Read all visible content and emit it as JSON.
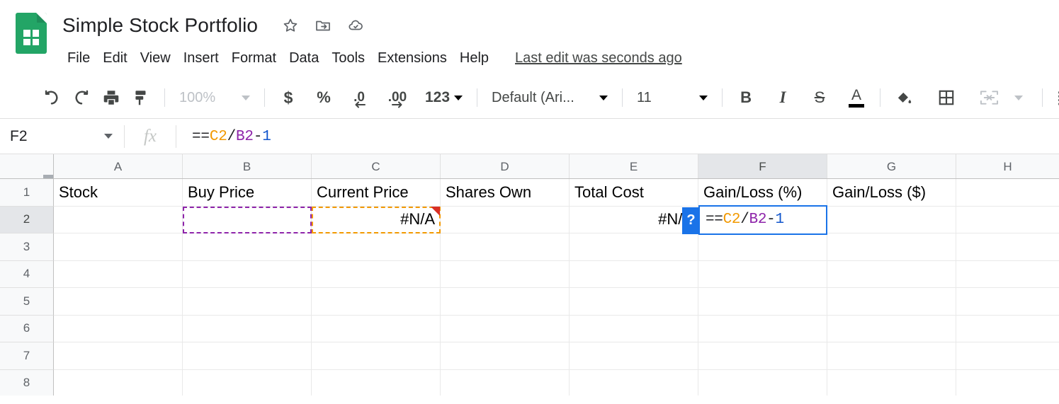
{
  "app": {
    "logo_name": "google-sheets-logo",
    "title": "Simple Stock Portfolio",
    "title_icons": [
      {
        "name": "star-icon",
        "label": "Star"
      },
      {
        "name": "move-to-folder-icon",
        "label": "Move"
      },
      {
        "name": "cloud-saved-icon",
        "label": "Saved to Drive"
      }
    ],
    "last_edit": "Last edit was seconds ago"
  },
  "menubar": {
    "items": [
      {
        "name": "menu-file",
        "label": "File"
      },
      {
        "name": "menu-edit",
        "label": "Edit"
      },
      {
        "name": "menu-view",
        "label": "View"
      },
      {
        "name": "menu-insert",
        "label": "Insert"
      },
      {
        "name": "menu-format",
        "label": "Format"
      },
      {
        "name": "menu-data",
        "label": "Data"
      },
      {
        "name": "menu-tools",
        "label": "Tools"
      },
      {
        "name": "menu-extensions",
        "label": "Extensions"
      },
      {
        "name": "menu-help",
        "label": "Help"
      }
    ]
  },
  "toolbar": {
    "undo": "undo-icon",
    "redo": "redo-icon",
    "print": "print-icon",
    "paint_format": "paint-format-icon",
    "zoom_value": "100%",
    "currency": "$",
    "percent": "%",
    "decrease_decimal": ".0",
    "increase_decimal": ".00",
    "number_format": "123",
    "font_family": "Default (Ari...",
    "font_size": "11",
    "bold": "B",
    "italic": "I",
    "strikethrough": "S",
    "text_color": "A",
    "text_color_swatch": "#000000",
    "fill_color": "fill-color-icon",
    "borders": "borders-icon",
    "merge_cells": "merge-cells-icon",
    "align": "align-left-icon"
  },
  "formula_bar": {
    "name_box": "F2",
    "fx_label": "fx",
    "formula_tokens": [
      {
        "text": "==",
        "color": "#202124"
      },
      {
        "text": "C2",
        "color": "#F29900"
      },
      {
        "text": "/",
        "color": "#202124"
      },
      {
        "text": "B2",
        "color": "#8E24AA"
      },
      {
        "text": "-",
        "color": "#202124"
      },
      {
        "text": "1",
        "color": "#1155CC"
      }
    ]
  },
  "sheet": {
    "column_headers": [
      "A",
      "B",
      "C",
      "D",
      "E",
      "F",
      "G",
      "H"
    ],
    "active_column": "F",
    "active_row": "2",
    "row_headers": [
      "1",
      "2",
      "3",
      "4",
      "5",
      "6",
      "7",
      "8"
    ],
    "rows": [
      {
        "number": "1",
        "cells": [
          {
            "name": "cell-A1",
            "value": "Stock",
            "align": "left"
          },
          {
            "name": "cell-B1",
            "value": "Buy Price",
            "align": "left"
          },
          {
            "name": "cell-C1",
            "value": "Current Price",
            "align": "left"
          },
          {
            "name": "cell-D1",
            "value": "Shares Own",
            "align": "left"
          },
          {
            "name": "cell-E1",
            "value": "Total Cost",
            "align": "left"
          },
          {
            "name": "cell-F1",
            "value": "Gain/Loss (%)",
            "align": "left"
          },
          {
            "name": "cell-G1",
            "value": "Gain/Loss ($)",
            "align": "left"
          },
          {
            "name": "cell-H1",
            "value": "",
            "align": "left"
          }
        ]
      },
      {
        "number": "2",
        "cells": [
          {
            "name": "cell-A2",
            "value": "",
            "align": "left"
          },
          {
            "name": "cell-B2",
            "value": "",
            "align": "left"
          },
          {
            "name": "cell-C2",
            "value": "#N/A",
            "align": "right"
          },
          {
            "name": "cell-D2",
            "value": "",
            "align": "left"
          },
          {
            "name": "cell-E2",
            "value": "#N/A",
            "align": "right"
          },
          {
            "name": "cell-F2",
            "value": "",
            "align": "left"
          },
          {
            "name": "cell-G2",
            "value": "",
            "align": "left"
          },
          {
            "name": "cell-H2",
            "value": "",
            "align": "left"
          }
        ]
      },
      {
        "number": "3",
        "cells": [
          {
            "name": "cell-A3",
            "value": "",
            "align": "left"
          },
          {
            "name": "cell-B3",
            "value": "",
            "align": "left"
          },
          {
            "name": "cell-C3",
            "value": "",
            "align": "left"
          },
          {
            "name": "cell-D3",
            "value": "",
            "align": "left"
          },
          {
            "name": "cell-E3",
            "value": "",
            "align": "left"
          },
          {
            "name": "cell-F3",
            "value": "",
            "align": "left"
          },
          {
            "name": "cell-G3",
            "value": "",
            "align": "left"
          },
          {
            "name": "cell-H3",
            "value": "",
            "align": "left"
          }
        ]
      },
      {
        "number": "4",
        "cells": [
          {
            "name": "cell-A4",
            "value": "",
            "align": "left"
          },
          {
            "name": "cell-B4",
            "value": "",
            "align": "left"
          },
          {
            "name": "cell-C4",
            "value": "",
            "align": "left"
          },
          {
            "name": "cell-D4",
            "value": "",
            "align": "left"
          },
          {
            "name": "cell-E4",
            "value": "",
            "align": "left"
          },
          {
            "name": "cell-F4",
            "value": "",
            "align": "left"
          },
          {
            "name": "cell-G4",
            "value": "",
            "align": "left"
          },
          {
            "name": "cell-H4",
            "value": "",
            "align": "left"
          }
        ]
      },
      {
        "number": "5",
        "cells": [
          {
            "name": "cell-A5",
            "value": "",
            "align": "left"
          },
          {
            "name": "cell-B5",
            "value": "",
            "align": "left"
          },
          {
            "name": "cell-C5",
            "value": "",
            "align": "left"
          },
          {
            "name": "cell-D5",
            "value": "",
            "align": "left"
          },
          {
            "name": "cell-E5",
            "value": "",
            "align": "left"
          },
          {
            "name": "cell-F5",
            "value": "",
            "align": "left"
          },
          {
            "name": "cell-G5",
            "value": "",
            "align": "left"
          },
          {
            "name": "cell-H5",
            "value": "",
            "align": "left"
          }
        ]
      },
      {
        "number": "6",
        "cells": [
          {
            "name": "cell-A6",
            "value": "",
            "align": "left"
          },
          {
            "name": "cell-B6",
            "value": "",
            "align": "left"
          },
          {
            "name": "cell-C6",
            "value": "",
            "align": "left"
          },
          {
            "name": "cell-D6",
            "value": "",
            "align": "left"
          },
          {
            "name": "cell-E6",
            "value": "",
            "align": "left"
          },
          {
            "name": "cell-F6",
            "value": "",
            "align": "left"
          },
          {
            "name": "cell-G6",
            "value": "",
            "align": "left"
          },
          {
            "name": "cell-H6",
            "value": "",
            "align": "left"
          }
        ]
      },
      {
        "number": "7",
        "cells": [
          {
            "name": "cell-A7",
            "value": "",
            "align": "left"
          },
          {
            "name": "cell-B7",
            "value": "",
            "align": "left"
          },
          {
            "name": "cell-C7",
            "value": "",
            "align": "left"
          },
          {
            "name": "cell-D7",
            "value": "",
            "align": "left"
          },
          {
            "name": "cell-E7",
            "value": "",
            "align": "left"
          },
          {
            "name": "cell-F7",
            "value": "",
            "align": "left"
          },
          {
            "name": "cell-G7",
            "value": "",
            "align": "left"
          },
          {
            "name": "cell-H7",
            "value": "",
            "align": "left"
          }
        ]
      },
      {
        "number": "8",
        "cells": [
          {
            "name": "cell-A8",
            "value": "",
            "align": "left"
          },
          {
            "name": "cell-B8",
            "value": "",
            "align": "left"
          },
          {
            "name": "cell-C8",
            "value": "",
            "align": "left"
          },
          {
            "name": "cell-D8",
            "value": "",
            "align": "left"
          },
          {
            "name": "cell-E8",
            "value": "",
            "align": "left"
          },
          {
            "name": "cell-F8",
            "value": "",
            "align": "left"
          },
          {
            "name": "cell-G8",
            "value": "",
            "align": "left"
          },
          {
            "name": "cell-H8",
            "value": "",
            "align": "left"
          }
        ]
      }
    ],
    "editor": {
      "cell": "F2",
      "help_badge": "?",
      "tokens": [
        {
          "text": "==",
          "color": "#202124"
        },
        {
          "text": "C2",
          "color": "#F29900"
        },
        {
          "text": "/",
          "color": "#202124"
        },
        {
          "text": "B2",
          "color": "#8E24AA"
        },
        {
          "text": "-",
          "color": "#202124"
        },
        {
          "text": "1",
          "color": "#1155CC"
        }
      ]
    },
    "reference_highlights": [
      {
        "cell": "B2",
        "color": "#8E24AA"
      },
      {
        "cell": "C2",
        "color": "#F29900"
      }
    ],
    "error_marker": {
      "cell": "C2",
      "color": "#D93025"
    }
  }
}
